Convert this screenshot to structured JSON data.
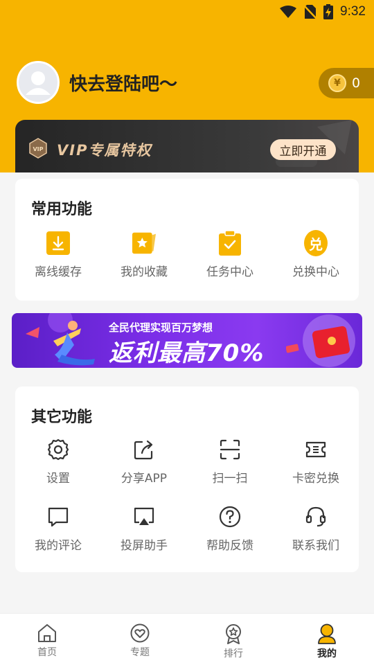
{
  "status_bar": {
    "time": "9:32"
  },
  "profile": {
    "login_prompt": "快去登陆吧～",
    "coins": "0",
    "coin_symbol": "¥"
  },
  "vip": {
    "title": "VIP专属特权",
    "badge_text": "VIP",
    "button": "立即开通"
  },
  "common": {
    "title": "常用功能",
    "items": [
      {
        "label": "离线缓存",
        "icon": "download-icon"
      },
      {
        "label": "我的收藏",
        "icon": "star-bookmark-icon"
      },
      {
        "label": "任务中心",
        "icon": "clipboard-check-icon"
      },
      {
        "label": "兑换中心",
        "icon": "exchange-icon",
        "glyph": "兑"
      }
    ]
  },
  "promo": {
    "subtitle": "全民代理实现百万梦想",
    "headline": "返利最高70%"
  },
  "other": {
    "title": "其它功能",
    "items": [
      {
        "label": "设置",
        "icon": "gear-icon"
      },
      {
        "label": "分享APP",
        "icon": "share-icon"
      },
      {
        "label": "扫一扫",
        "icon": "scan-icon"
      },
      {
        "label": "卡密兑换",
        "icon": "ticket-icon"
      },
      {
        "label": "我的评论",
        "icon": "comment-icon"
      },
      {
        "label": "投屏助手",
        "icon": "cast-screen-icon"
      },
      {
        "label": "帮助反馈",
        "icon": "help-icon"
      },
      {
        "label": "联系我们",
        "icon": "headset-icon"
      }
    ]
  },
  "nav": {
    "items": [
      {
        "label": "首页",
        "icon": "home-icon"
      },
      {
        "label": "专题",
        "icon": "heart-chat-icon"
      },
      {
        "label": "排行",
        "icon": "award-icon"
      },
      {
        "label": "我的",
        "icon": "user-icon"
      }
    ],
    "active": "我的"
  },
  "colors": {
    "brand": "#f7b400",
    "vip_text": "#e8c7a0",
    "promo_purple": "#7b2ee8"
  }
}
